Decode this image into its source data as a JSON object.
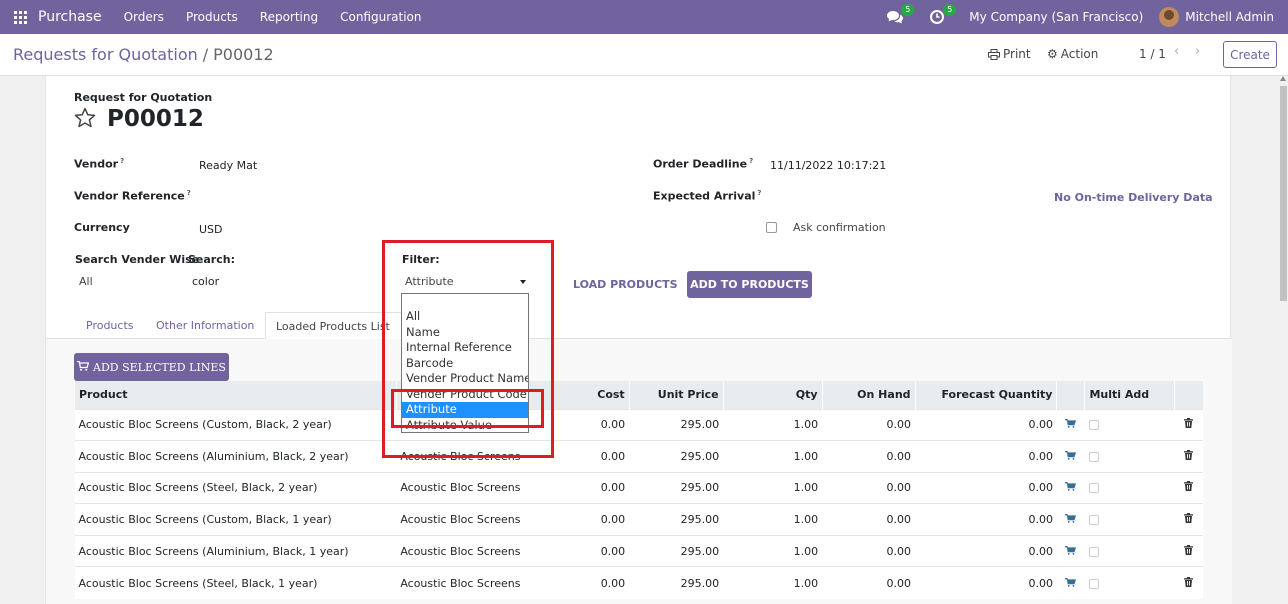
{
  "navbar": {
    "brand": "Purchase",
    "menus": [
      "Orders",
      "Products",
      "Reporting",
      "Configuration"
    ],
    "chat_badge": "5",
    "activity_badge": "5",
    "company": "My Company (San Francisco)",
    "user": "Mitchell Admin"
  },
  "control": {
    "breadcrumb_parent": "Requests for Quotation",
    "breadcrumb_sep": "/",
    "breadcrumb_current": "P00012",
    "print_label": "Print",
    "action_label": "Action",
    "pager": "1 / 1",
    "prev": "‹",
    "next": "›",
    "create_label": "Create"
  },
  "form": {
    "doc_type": "Request for Quotation",
    "name": "P00012",
    "vendor_label": "Vendor",
    "vendor_value": "Ready Mat",
    "vendor_ref_label": "Vendor Reference",
    "currency_label": "Currency",
    "currency_value": "USD",
    "order_deadline_label": "Order Deadline",
    "order_deadline_value": "11/11/2022 10:17:21",
    "expected_arrival_label": "Expected Arrival",
    "delivery_data": "No On-time Delivery Data",
    "ask_confirmation_label": "Ask confirmation",
    "tooltip_mark": "?"
  },
  "search": {
    "vendor_wise_label": "Search Vender Wise",
    "vendor_wise_value": "All",
    "search_label": "Search:",
    "search_value": "color",
    "filter_label": "Filter:",
    "filter_value": "Attribute",
    "filter_options": [
      "All",
      "Name",
      "Internal Reference",
      "Barcode",
      "Vender Product Name",
      "Vender Product Code",
      "Attribute",
      "Attribute Value"
    ],
    "load_products_label": "LOAD PRODUCTS",
    "add_to_products_label": "ADD TO PRODUCTS"
  },
  "tabs": [
    "Products",
    "Other Information",
    "Loaded Products List"
  ],
  "table": {
    "add_selected_label": "ADD SELECTED LINES",
    "headers": {
      "product": "Product",
      "cost": "Cost",
      "unit_price": "Unit Price",
      "qty": "Qty",
      "on_hand": "On Hand",
      "forecast": "Forecast Quantity",
      "multi_add": "Multi Add"
    },
    "rows": [
      {
        "product": "Acoustic Bloc Screens (Custom, Black, 2 year)",
        "template": "",
        "cost": "0.00",
        "unit_price": "295.00",
        "qty": "1.00",
        "on_hand": "0.00",
        "forecast": "0.00"
      },
      {
        "product": "Acoustic Bloc Screens (Aluminium, Black, 2 year)",
        "template": "Acoustic Bloc Screens",
        "cost": "0.00",
        "unit_price": "295.00",
        "qty": "1.00",
        "on_hand": "0.00",
        "forecast": "0.00"
      },
      {
        "product": "Acoustic Bloc Screens (Steel, Black, 2 year)",
        "template": "Acoustic Bloc Screens",
        "cost": "0.00",
        "unit_price": "295.00",
        "qty": "1.00",
        "on_hand": "0.00",
        "forecast": "0.00"
      },
      {
        "product": "Acoustic Bloc Screens (Custom, Black, 1 year)",
        "template": "Acoustic Bloc Screens",
        "cost": "0.00",
        "unit_price": "295.00",
        "qty": "1.00",
        "on_hand": "0.00",
        "forecast": "0.00"
      },
      {
        "product": "Acoustic Bloc Screens (Aluminium, Black, 1 year)",
        "template": "Acoustic Bloc Screens",
        "cost": "0.00",
        "unit_price": "295.00",
        "qty": "1.00",
        "on_hand": "0.00",
        "forecast": "0.00"
      },
      {
        "product": "Acoustic Bloc Screens (Steel, Black, 1 year)",
        "template": "Acoustic Bloc Screens",
        "cost": "0.00",
        "unit_price": "295.00",
        "qty": "1.00",
        "on_hand": "0.00",
        "forecast": "0.00"
      }
    ]
  },
  "colors": {
    "brand": "#71639e",
    "highlight": "#e01b24",
    "selection": "#1e90ff",
    "badge": "#28a745"
  }
}
